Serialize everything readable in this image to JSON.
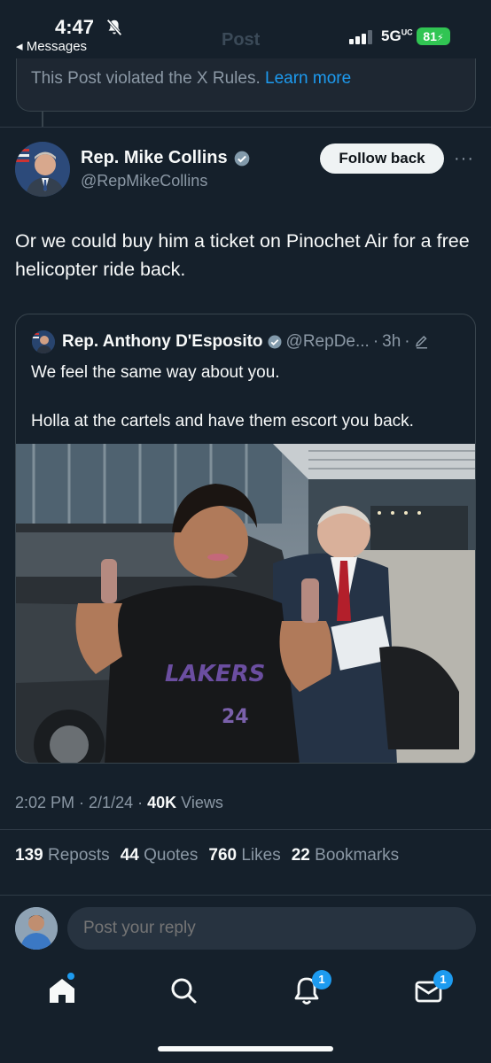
{
  "status": {
    "time": "4:47",
    "back_app": "◂ Messages",
    "header_title": "Post",
    "network": "5G",
    "network_suffix": "UC",
    "battery": "81"
  },
  "violation": {
    "text": "This Post violated the X Rules.",
    "link": "Learn more"
  },
  "tweet": {
    "author_name": "Rep. Mike Collins",
    "author_handle": "@RepMikeCollins",
    "follow_label": "Follow back",
    "more_label": "···",
    "text": "Or we could buy him a ticket on Pinochet Air for a free helicopter ride back.",
    "time": "2:02 PM",
    "date": "2/1/24",
    "views_count": "40K",
    "views_label": "Views"
  },
  "quote": {
    "author_name": "Rep. Anthony D'Esposito",
    "author_handle": "@RepDe...",
    "age": "3h",
    "line1": "We feel the same way about you.",
    "line2": "Holla at the cartels and have them escort you back.",
    "image_jersey_text": "LAKERS",
    "image_jersey_number": "24"
  },
  "stats": {
    "reposts_count": "139",
    "reposts_label": "Reposts",
    "quotes_count": "44",
    "quotes_label": "Quotes",
    "likes_count": "760",
    "likes_label": "Likes",
    "bookmarks_count": "22",
    "bookmarks_label": "Bookmarks"
  },
  "reply": {
    "placeholder": "Post your reply"
  },
  "tabbar": {
    "notifications_badge": "1",
    "messages_badge": "1"
  },
  "colors": {
    "background": "#15202b",
    "accent": "#1d9bf0",
    "muted": "#8b98a5",
    "battery": "#31c553"
  }
}
